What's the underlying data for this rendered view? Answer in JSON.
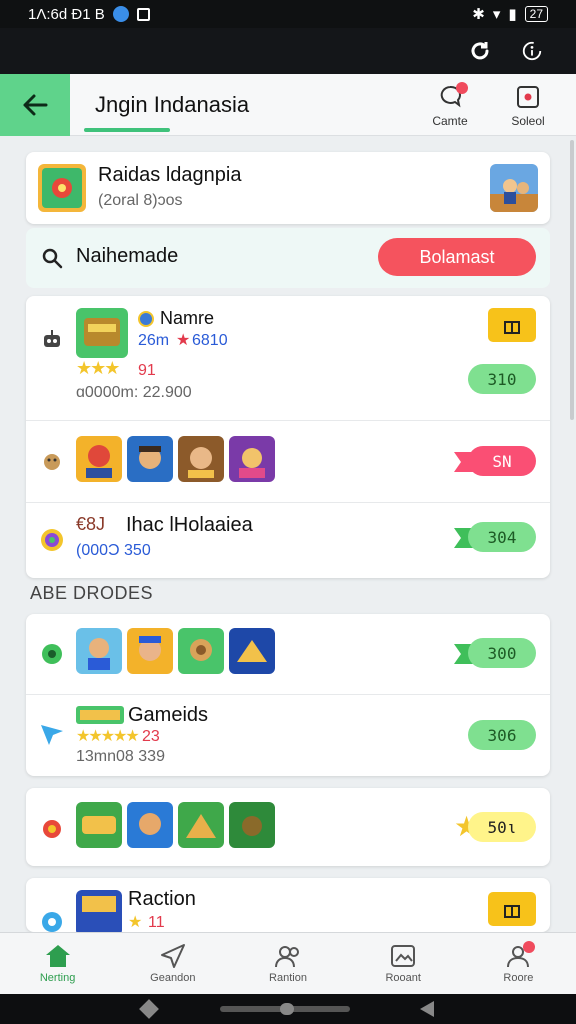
{
  "status_bar": {
    "time_text": "1Λ:6d Đ1 B",
    "battery_text": "27"
  },
  "app_bar": {
    "title": "Jngin Indanasia",
    "actions": [
      {
        "label": "Camte",
        "icon": "chat-bubble-icon"
      },
      {
        "label": "Soleol",
        "icon": "square-dot-icon"
      }
    ]
  },
  "featured": {
    "title": "Raidas ldagnpia",
    "subtitle": "(2oral 8)ɔos"
  },
  "search": {
    "label": "Naihemade",
    "button_label": "Bolamast"
  },
  "card1": {
    "row1": {
      "name": "Namre",
      "meta": "26m",
      "meta2": "6810",
      "rating_count": "91",
      "count_text": "ɑ0000m: 22.900",
      "pill": "310"
    },
    "row2": {
      "pill": "SN"
    },
    "row3": {
      "prefix": "€8J",
      "title": "Ihac lHolaaiea",
      "sub": "(000Ͻ 350",
      "pill": "304"
    }
  },
  "section_title": "ABE DRODES",
  "card2": {
    "row1": {
      "pill": "300"
    },
    "row2": {
      "title": "Gameids",
      "rating_text": "23",
      "sub": "13mn08 339",
      "pill": "306"
    }
  },
  "card3": {
    "pill": "50ι"
  },
  "card4": {
    "title": "Raction",
    "rating_text": "11"
  },
  "bottom_nav": [
    {
      "label": "Nerting",
      "icon": "home-icon",
      "active": true
    },
    {
      "label": "Geandon",
      "icon": "send-icon",
      "active": false
    },
    {
      "label": "Rantion",
      "icon": "people-icon",
      "active": false
    },
    {
      "label": "Rooant",
      "icon": "image-icon",
      "active": false
    },
    {
      "label": "Roore",
      "icon": "profile-icon",
      "active": false
    }
  ],
  "colors": {
    "accent_green": "#5fd38b",
    "pill_green": "#7fe090",
    "pill_pink": "#fa4f74",
    "button_red": "#f5535e",
    "gift_yellow": "#f7c21a"
  }
}
